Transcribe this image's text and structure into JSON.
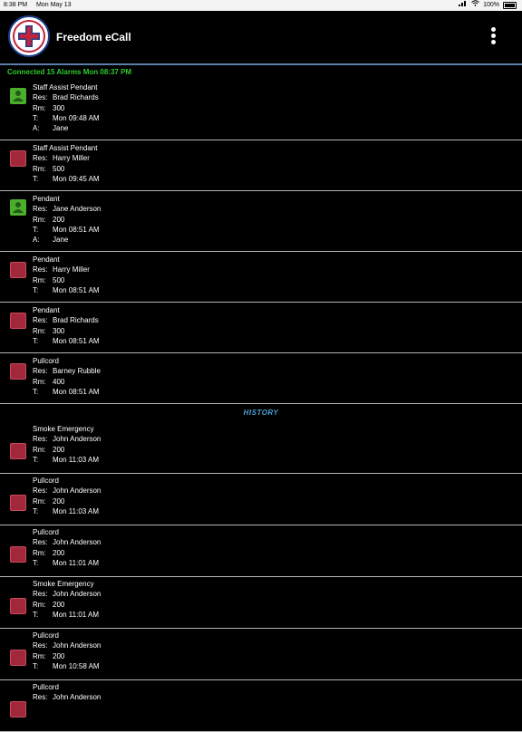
{
  "status_bar": {
    "time": "8:38 PM",
    "date": "Mon May 13",
    "battery": "100%"
  },
  "app": {
    "title": "Freedom eCall"
  },
  "connection_status": "Connected 15 Alarms Mon 08:37 PM",
  "labels": {
    "res": "Res:",
    "rm": "Rm:",
    "t": "T:",
    "a": "A:"
  },
  "active_alarms": [
    {
      "type": "Staff Assist Pendant",
      "res": "Brad Richards",
      "rm": "300",
      "t": "Mon 09:48 AM",
      "a": "Jane",
      "status": "green"
    },
    {
      "type": "Staff Assist Pendant",
      "res": "Harry Miller",
      "rm": "500",
      "t": "Mon 09:45 AM",
      "status": "red"
    },
    {
      "type": "Pendant",
      "res": "Jane Anderson",
      "rm": "200",
      "t": "Mon 08:51 AM",
      "a": "Jane",
      "status": "green"
    },
    {
      "type": "Pendant",
      "res": "Harry Miller",
      "rm": "500",
      "t": "Mon 08:51 AM",
      "status": "red"
    },
    {
      "type": "Pendant",
      "res": "Brad Richards",
      "rm": "300",
      "t": "Mon 08:51 AM",
      "status": "red"
    },
    {
      "type": "Pullcord",
      "res": "Barney Rubble",
      "rm": "400",
      "t": "Mon 08:51 AM",
      "status": "red"
    }
  ],
  "history_label": "HISTORY",
  "history": [
    {
      "type": "Smoke Emergency",
      "res": "John Anderson",
      "rm": "200",
      "t": "Mon 11:03 AM"
    },
    {
      "type": "Pullcord",
      "res": "John Anderson",
      "rm": "200",
      "t": "Mon 11:03 AM"
    },
    {
      "type": "Pullcord",
      "res": "John Anderson",
      "rm": "200",
      "t": "Mon 11:01 AM"
    },
    {
      "type": "Smoke Emergency",
      "res": "John Anderson",
      "rm": "200",
      "t": "Mon 11:01 AM"
    },
    {
      "type": "Pullcord",
      "res": "John Anderson",
      "rm": "200",
      "t": "Mon 10:58 AM"
    },
    {
      "type": "Pullcord",
      "res": "John Anderson",
      "rm": "",
      "t": ""
    }
  ],
  "colors": {
    "accent_green": "#2ecc2e",
    "history_blue": "#4f9fd6",
    "alarm_red": "#a1283a",
    "ack_green": "#4cae2b"
  },
  "icons": {
    "menu": "more-vertical-icon",
    "wifi": "wifi-icon",
    "battery": "battery-icon",
    "logo": "cross-logo"
  }
}
